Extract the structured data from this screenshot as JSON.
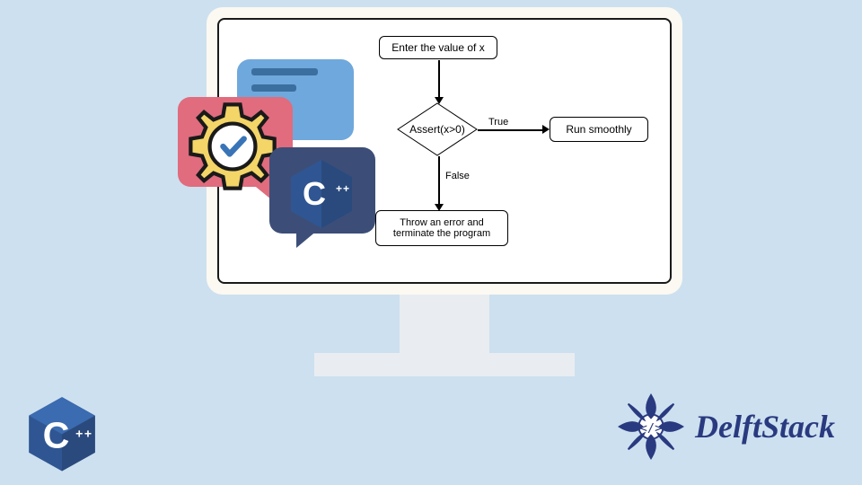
{
  "flowchart": {
    "start": "Enter the value of x",
    "decision": "Assert(x>0)",
    "true_label": "True",
    "false_label": "False",
    "true_box": "Run smoothly",
    "false_box": "Throw an error and terminate the program"
  },
  "brand": {
    "name": "DelftStack"
  },
  "icons": {
    "cpp_letter": "C",
    "cpp_plus": "++"
  },
  "colors": {
    "bg": "#cde0ef",
    "bubble_blue": "#6fa8dc",
    "bubble_red": "#e06c7d",
    "bubble_navy": "#3c4e78",
    "gear_yellow": "#f3d568",
    "brand_blue": "#2a3a80"
  }
}
